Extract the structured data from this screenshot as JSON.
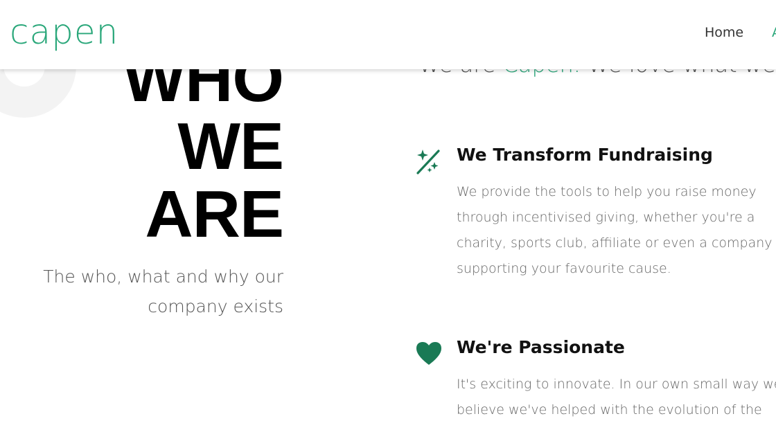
{
  "header": {
    "logo": "capen",
    "nav": {
      "home": "Home",
      "next_partial": "A"
    }
  },
  "intro": {
    "tagline_prefix": "We are ",
    "tagline_brand": "Capen.",
    "tagline_suffix": " We love what we do"
  },
  "hero": {
    "line1": "WHO",
    "line2": "WE",
    "line3": "ARE",
    "subtitle": "The who, what and why our company exists"
  },
  "features": [
    {
      "icon": "magic-wand-sparkles-icon",
      "title": "We Transform Fundraising",
      "text": "We provide the tools to help you raise money through incentivised giving, whether you're a charity, sports club, affiliate or even a company supporting your favourite cause."
    },
    {
      "icon": "heart-icon",
      "title": "We're Passionate",
      "line1": "It's exciting to innovate. In our own small way we",
      "line2": "believe we've helped with the evolution of the"
    }
  ],
  "colors": {
    "brand": "#2aa77a",
    "icon": "#1a7a55"
  }
}
